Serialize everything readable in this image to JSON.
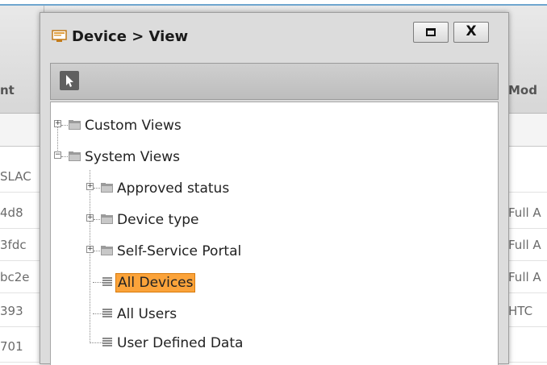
{
  "background_table": {
    "left_header": "nt",
    "right_header": "Mod",
    "rows": [
      {
        "left": "SLAC",
        "right": ""
      },
      {
        "left": "4d8",
        "right": "Full A"
      },
      {
        "left": "3fdc",
        "right": "Full A"
      },
      {
        "left": "bc2e",
        "right": "Full A"
      },
      {
        "left": "393",
        "right": "HTC"
      },
      {
        "left": "701",
        "right": ""
      }
    ]
  },
  "dialog": {
    "title": "Device > View",
    "icon": "monitor-icon",
    "buttons": {
      "maximize": "maximize-icon",
      "close": "X"
    },
    "toolbar": {
      "tool": "pointer-icon"
    },
    "tree": {
      "custom_views": "Custom Views",
      "system_views": "System Views",
      "approved_status": "Approved status",
      "device_type": "Device type",
      "self_service_portal": "Self-Service Portal",
      "all_devices": "All Devices",
      "all_users": "All Users",
      "user_defined_data": "User Defined Data"
    },
    "selected": "All Devices",
    "colors": {
      "selection": "#fba33a",
      "selection_border": "#d87a0b"
    }
  }
}
